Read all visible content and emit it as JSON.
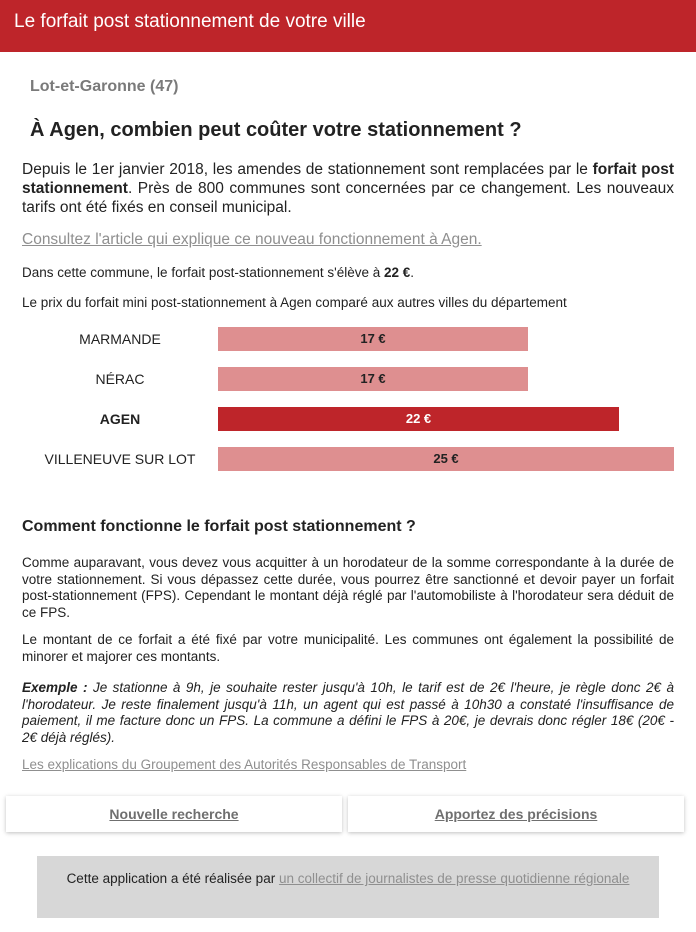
{
  "header": {
    "title": "Le forfait post stationnement de votre ville"
  },
  "region": "Lot-et-Garonne (47)",
  "headline": "À Agen, combien peut coûter votre stationnement ?",
  "intro": {
    "part1": "Depuis le 1er janvier 2018, les amendes de stationnement sont remplacées par le ",
    "bold": "forfait post stationnement",
    "part2": ". Près de 800 communes sont concernées par ce changement. Les nouveaux tarifs ont été fixés en conseil municipal."
  },
  "article_link": "Consultez l'article qui explique ce nouveau fonctionnement à Agen.",
  "amount_line": {
    "text": "Dans cette commune, le forfait post-stationnement s'élève à ",
    "amount": "22 €",
    "suffix": "."
  },
  "comparison_intro": "Le prix du forfait mini post-stationnement à Agen comparé aux autres villes du département",
  "chart_data": {
    "type": "bar",
    "orientation": "horizontal",
    "categories": [
      "MARMANDE",
      "NÉRAC",
      "AGEN",
      "VILLENEUVE SUR LOT"
    ],
    "values": [
      17,
      17,
      22,
      25
    ],
    "value_labels": [
      "17 €",
      "17 €",
      "22 €",
      "25 €"
    ],
    "highlight": "AGEN",
    "colors": {
      "default": "#de8f90",
      "highlight": "#be252a"
    },
    "xlim": [
      0,
      25
    ]
  },
  "section_title": "Comment fonctionne le forfait post stationnement ?",
  "paragraph1": "Comme auparavant, vous devez vous acquitter à un horodateur de la somme correspondante à la durée de votre stationnement. Si vous dépassez cette durée, vous pourrez être sanctionné et devoir payer un forfait post-stationnement (FPS). Cependant le montant déjà réglé par l'automobiliste à l'horodateur sera déduit de ce FPS.",
  "paragraph2": "Le montant de ce forfait a été fixé par votre municipalité. Les communes ont également la possibilité de minorer et majorer ces montants.",
  "example": {
    "label": "Exemple :",
    "text": " Je stationne à 9h, je souhaite rester jusqu'à 10h, le tarif est de 2€ l'heure, je règle donc 2€ à l'horodateur. Je reste finalement jusqu'à 11h, un agent qui est passé à 10h30 a constaté l'insuffisance de paiement, il me facture donc un FPS. La commune a défini le FPS à 20€, je devrais donc régler 18€ (20€ - 2€ déjà réglés)."
  },
  "gart_link": "Les explications du Groupement des Autorités Responsables de Transport",
  "buttons": {
    "new_search": "Nouvelle recherche",
    "contribute": "Apportez des précisions"
  },
  "footer": {
    "text": "Cette application a été réalisée par ",
    "link": "un collectif de journalistes de presse quotidienne régionale"
  },
  "colors": {
    "accent": "#be252a",
    "bar": "#de8f90",
    "footer_bg": "#d7d7d7",
    "link": "#8f8f8f"
  }
}
